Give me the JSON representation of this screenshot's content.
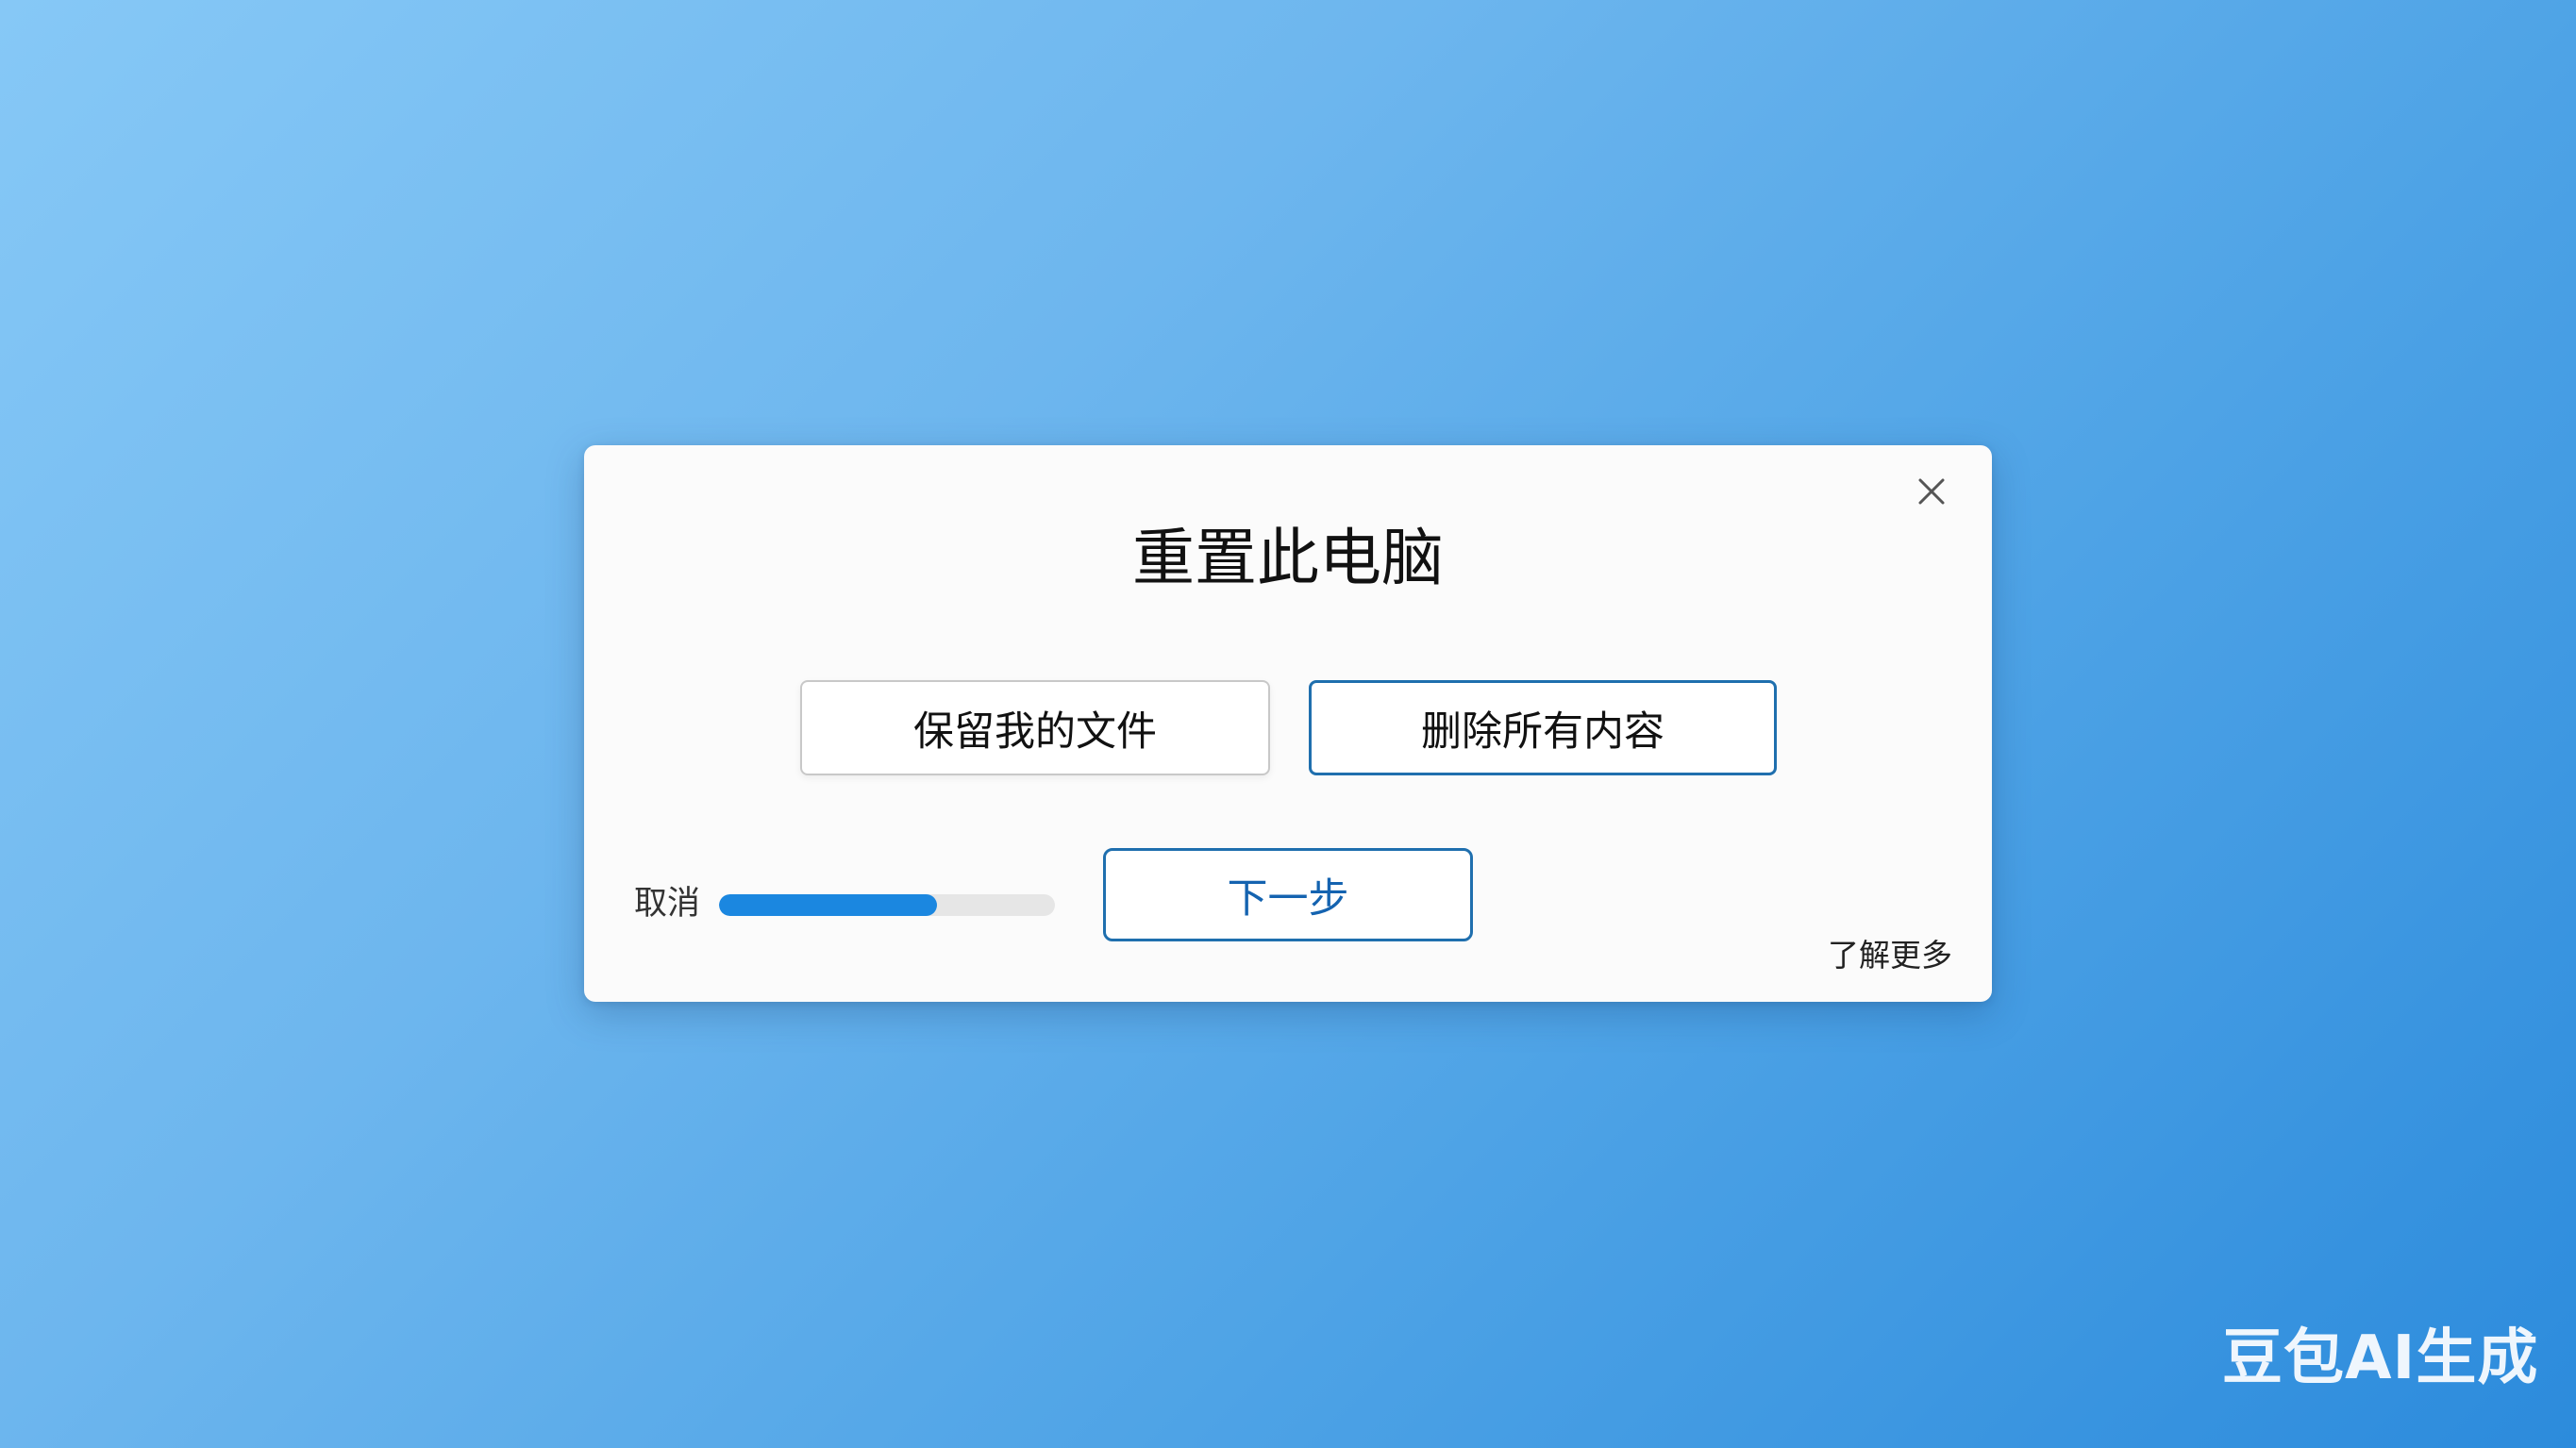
{
  "dialog": {
    "title": "重置此电脑",
    "close_icon": "close-icon",
    "options": {
      "keep_files_label": "保留我的文件",
      "remove_everything_label": "删除所有内容"
    },
    "cancel_label": "取消",
    "progress": {
      "fraction": 0.65,
      "fill_color": "#1b87e0",
      "track_color": "#e6e6e6"
    },
    "next_label": "下一步",
    "learn_more_label": "了解更多"
  },
  "watermark": {
    "text": "豆包AI生成"
  },
  "colors": {
    "accent": "#1f6fae",
    "next_text": "#1463b0",
    "background_start": "#86c8f6",
    "background_end": "#2c8bdc"
  }
}
